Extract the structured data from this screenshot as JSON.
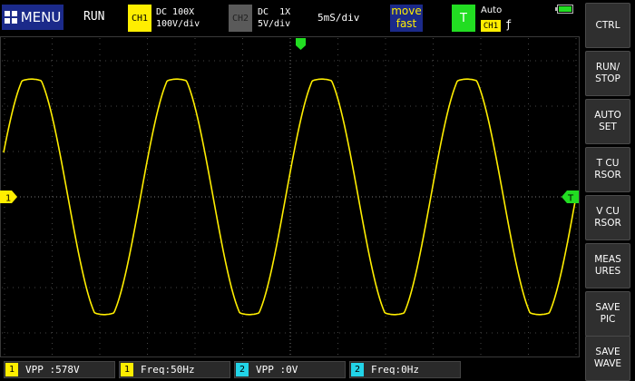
{
  "header": {
    "menu_label": "MENU",
    "run_state": "RUN",
    "ch1": {
      "badge": "CH1",
      "coupling": "DC 100X",
      "scale": "100V/div",
      "color": "#ffee00"
    },
    "ch2": {
      "badge": "CH2",
      "coupling": "DC  1X",
      "scale": "5V/div",
      "color": "#5a5a5a"
    },
    "timebase": "5mS/div",
    "move_mode": {
      "line1": "move",
      "line2": "fast"
    },
    "trigger": {
      "badge": "T",
      "mode": "Auto",
      "source": "CH1",
      "edge": "ƒ",
      "color": "#22dd22"
    },
    "battery_level": 1.0
  },
  "screen": {
    "ch1_marker": "1",
    "trigger_marker": "T",
    "trace_color": "#ffee00",
    "waveform": {
      "type": "sine",
      "frequency_hz": 50,
      "vpp_v": 578,
      "periods_visible": 4
    }
  },
  "sidebar": {
    "buttons": [
      {
        "id": "ctrl",
        "label": "CTRL"
      },
      {
        "id": "run-stop",
        "label": "RUN/\nSTOP"
      },
      {
        "id": "auto-set",
        "label": "AUTO\nSET"
      },
      {
        "id": "t-cursor",
        "label": "T CU\nRSOR"
      },
      {
        "id": "v-cursor",
        "label": "V CU\nRSOR"
      },
      {
        "id": "measures",
        "label": "MEAS\nURES"
      },
      {
        "id": "save-pic",
        "label": "SAVE\nPIC"
      },
      {
        "id": "save-wave",
        "label": "SAVE\nWAVE"
      }
    ]
  },
  "measurements": [
    {
      "channel": "1",
      "text": "VPP :578V",
      "color": "#ffee00"
    },
    {
      "channel": "1",
      "text": "Freq:50Hz",
      "color": "#ffee00"
    },
    {
      "channel": "2",
      "text": "VPP :0V",
      "color": "#22d4e8"
    },
    {
      "channel": "2",
      "text": "Freq:0Hz",
      "color": "#22d4e8"
    }
  ]
}
